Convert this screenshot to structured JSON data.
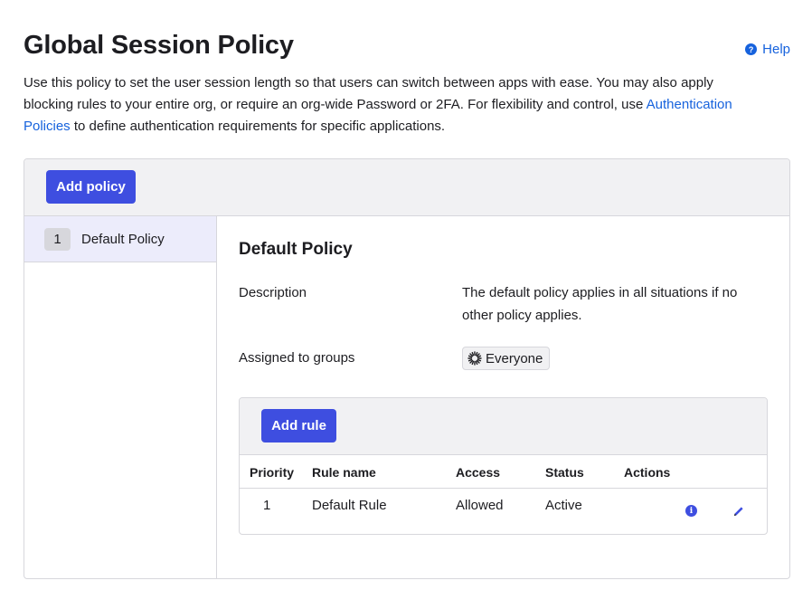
{
  "page": {
    "title": "Global Session Policy",
    "help_label": "Help",
    "intro_text": "Use this policy to set the user session length so that users can switch between apps with ease. You may also apply blocking rules to your entire org, or require an org-wide Password or 2FA. For flexibility and control, use ",
    "intro_link": "Authentication Policies",
    "intro_suffix": " to define authentication requirements for specific applications."
  },
  "toolbar": {
    "add_policy_label": "Add policy"
  },
  "sidebar": {
    "items": [
      {
        "priority": "1",
        "label": "Default Policy"
      }
    ]
  },
  "policy": {
    "title": "Default Policy",
    "description_label": "Description",
    "description_value": "The default policy applies in all situations if no other policy applies.",
    "groups_label": "Assigned to groups",
    "groups": [
      "Everyone"
    ]
  },
  "rules": {
    "add_rule_label": "Add rule",
    "columns": [
      "Priority",
      "Rule name",
      "Access",
      "Status",
      "Actions"
    ],
    "rows": [
      {
        "priority": "1",
        "name": "Default Rule",
        "access": "Allowed",
        "status": "Active"
      }
    ]
  },
  "colors": {
    "primary": "#3e4ee0",
    "link": "#1662dd",
    "toolbar_bg": "#f1f1f3",
    "selected_bg": "#ececfb"
  },
  "icons": {
    "help": "help-circle-icon",
    "group": "okta-burst-icon",
    "info": "info-icon",
    "edit": "pencil-icon"
  }
}
